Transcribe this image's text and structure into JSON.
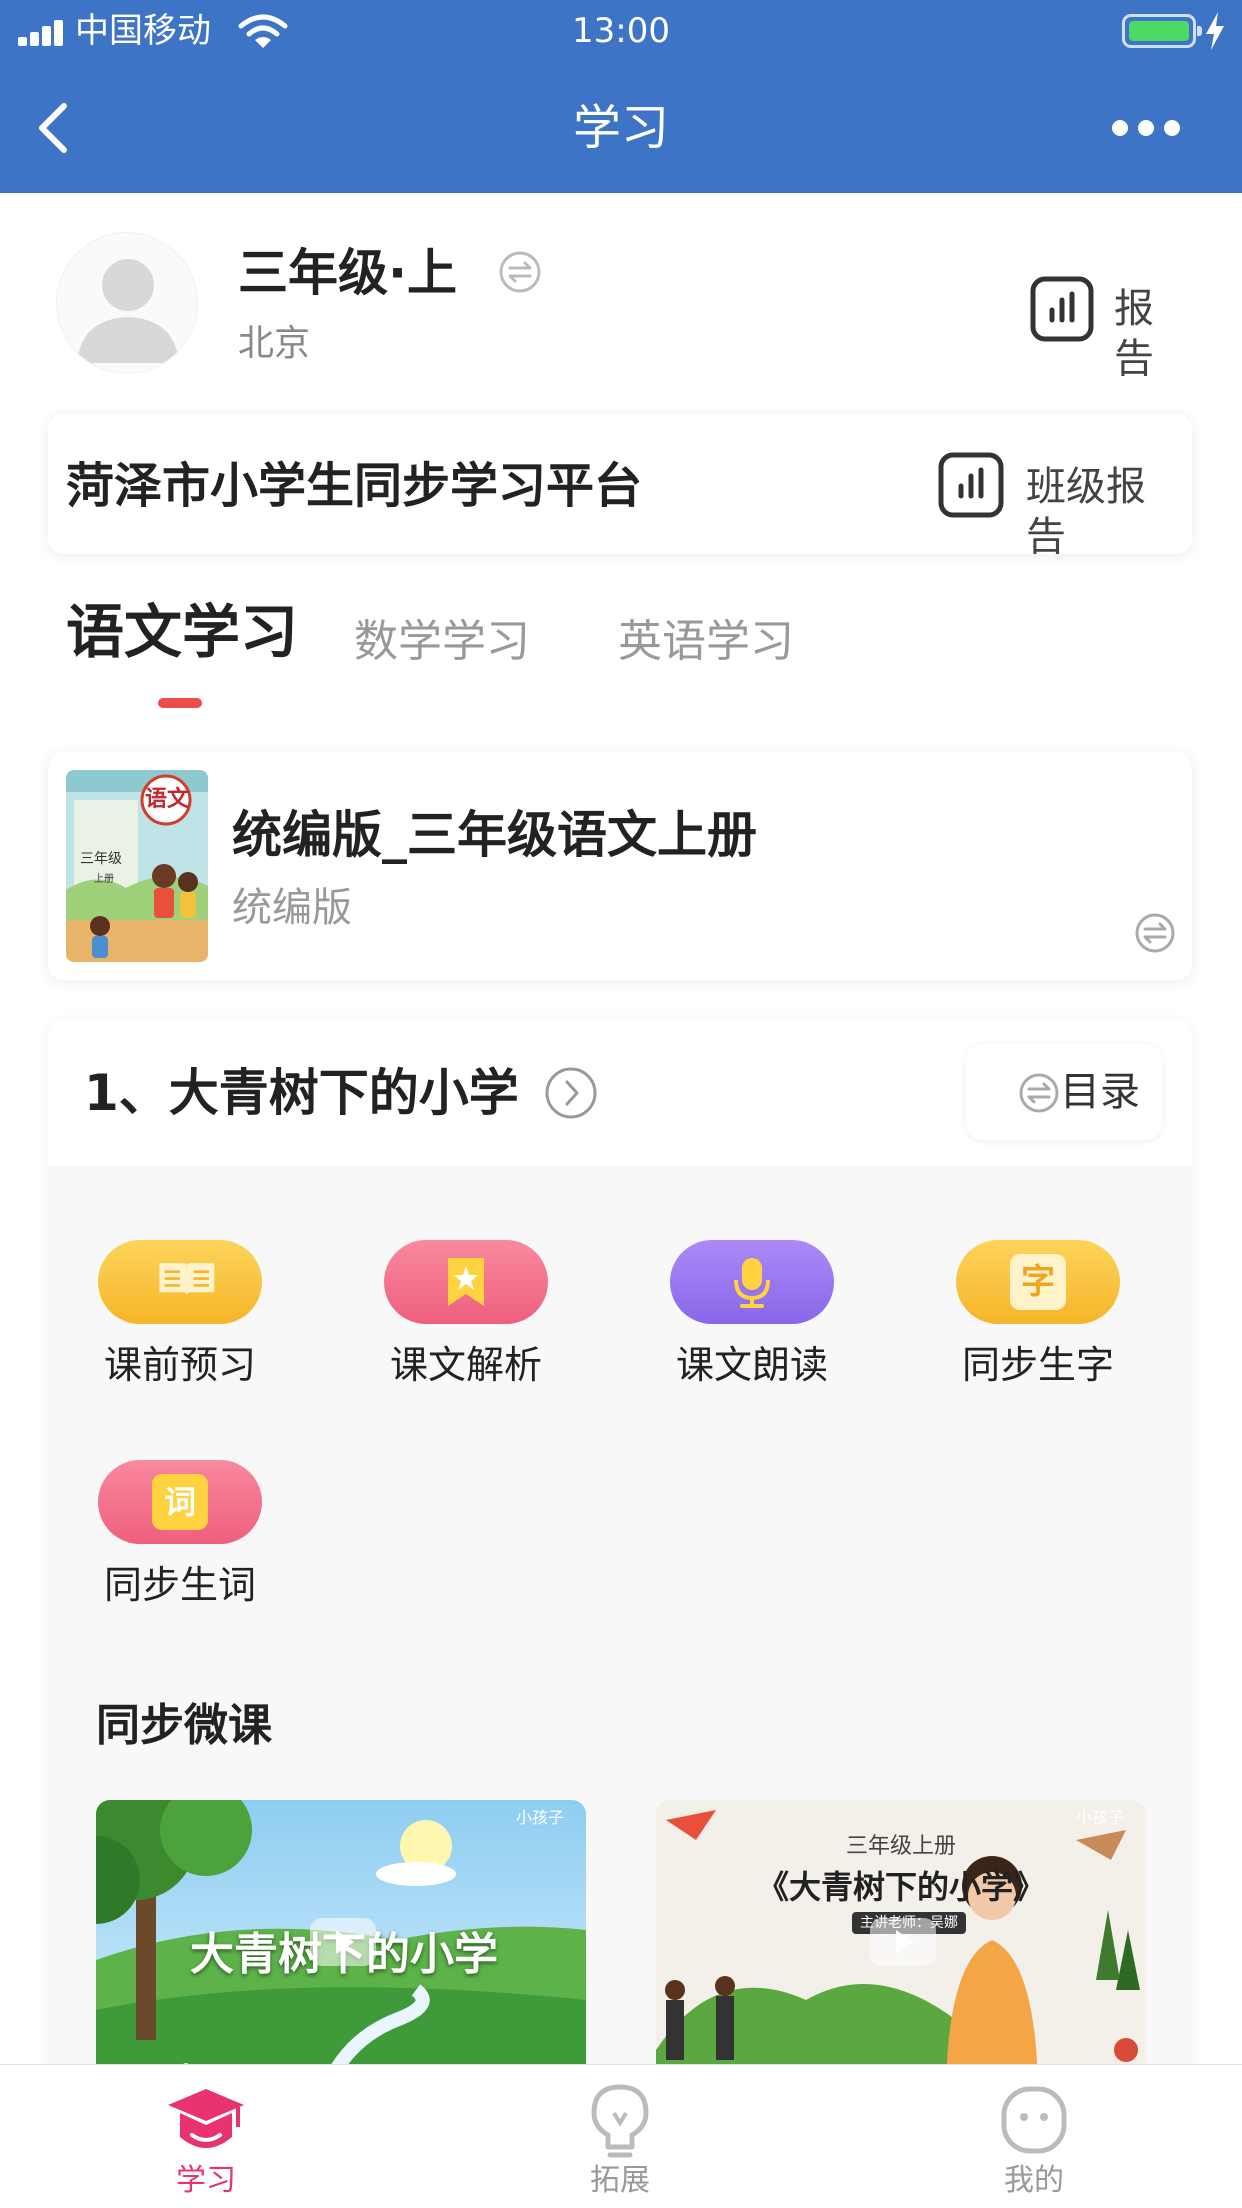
{
  "status_bar": {
    "carrier": "中国移动",
    "time": "13:00"
  },
  "nav": {
    "title": "学习"
  },
  "profile": {
    "grade": "三年级·上",
    "city": "北京",
    "report_label": "报告"
  },
  "platform": {
    "name": "菏泽市小学生同步学习平台",
    "class_report_label": "班级报告"
  },
  "subject_tabs": [
    {
      "label": "语文学习",
      "active": true
    },
    {
      "label": "数学学习",
      "active": false
    },
    {
      "label": "英语学习",
      "active": false
    }
  ],
  "book": {
    "title": "统编版_三年级语文上册",
    "edition": "统编版",
    "cover_badge": "语文",
    "cover_grade": "三年级",
    "cover_term": "上册"
  },
  "lesson": {
    "name": "1、大青树下的小学",
    "catalog_label": "目录"
  },
  "features": [
    {
      "label": "课前预习",
      "icon": "book-open-icon",
      "color": "#f9c53d"
    },
    {
      "label": "课文解析",
      "icon": "bookmark-star-icon",
      "color": "#f4768f"
    },
    {
      "label": "课文朗读",
      "icon": "microphone-icon",
      "color": "#9b79f0"
    },
    {
      "label": "同步生字",
      "icon": "character-icon",
      "color": "#f9c53d",
      "glyph": "字"
    },
    {
      "label": "同步生词",
      "icon": "word-icon",
      "color": "#f4768f",
      "glyph": "词"
    }
  ],
  "micro_lessons": {
    "title": "同步微课",
    "videos": [
      {
        "caption": "大青树下的小学",
        "watermark": "小孩子"
      },
      {
        "subtitle": "三年级上册",
        "caption": "《大青树下的小学》",
        "teacher": "主讲老师：吴娜",
        "watermark": "小孩子"
      }
    ]
  },
  "bottom_tabs": [
    {
      "label": "学习",
      "icon": "graduation-cap-icon",
      "active": true
    },
    {
      "label": "拓展",
      "icon": "lightbulb-icon",
      "active": false
    },
    {
      "label": "我的",
      "icon": "profile-face-icon",
      "active": false
    }
  ],
  "colors": {
    "nav_blue": "#3d74c6",
    "tab_indicator": "#ee4c4c",
    "active_tab": "#e8336e"
  }
}
